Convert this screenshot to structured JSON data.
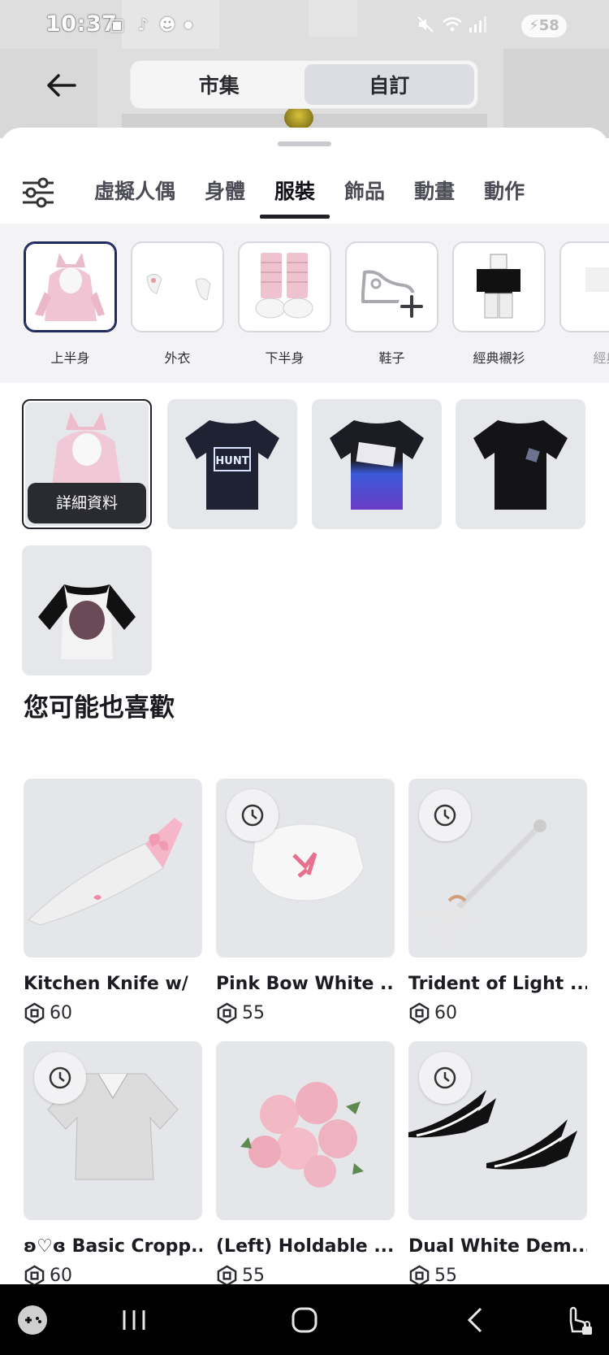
{
  "status_bar": {
    "time": "10:37",
    "battery": "58"
  },
  "top_nav": {
    "segments": [
      {
        "label": "市集",
        "active": false
      },
      {
        "label": "自訂",
        "active": true
      }
    ]
  },
  "category_tabs": [
    {
      "label": "虛擬人偶",
      "active": false
    },
    {
      "label": "身體",
      "active": false
    },
    {
      "label": "服裝",
      "active": true
    },
    {
      "label": "飾品",
      "active": false
    },
    {
      "label": "動畫",
      "active": false
    },
    {
      "label": "動作",
      "active": false
    }
  ],
  "subcategories": [
    {
      "label": "上半身",
      "icon": "pink-cat-hoodie-thumb",
      "active": true
    },
    {
      "label": "外衣",
      "icon": "outerwear-thumb",
      "active": false
    },
    {
      "label": "下半身",
      "icon": "pink-leg-warmers-thumb",
      "active": false
    },
    {
      "label": "鞋子",
      "icon": "add-shoe-icon",
      "active": false
    },
    {
      "label": "經典襯衫",
      "icon": "classic-shirt-thumb",
      "active": false
    },
    {
      "label": "經典",
      "icon": "classic-pants-thumb",
      "active": false
    }
  ],
  "owned_items": {
    "detail_label": "詳細資料",
    "items": [
      {
        "icon": "pink-cat-hoodie"
      },
      {
        "icon": "hunt-navy-tshirt"
      },
      {
        "icon": "gradient-blue-tshirt"
      },
      {
        "icon": "black-roblox-tshirt"
      },
      {
        "icon": "white-raglan-tshirt"
      }
    ]
  },
  "recommendations": {
    "title": "您可能也喜歡",
    "items": [
      {
        "name": "Kitchen Knife w/",
        "price": "60",
        "limited": false,
        "icon": "kitchen-knife"
      },
      {
        "name": "Pink Bow White ...",
        "price": "55",
        "limited": true,
        "icon": "pink-bow-top"
      },
      {
        "name": "Trident of Light ...",
        "price": "60",
        "limited": true,
        "icon": "trident"
      },
      {
        "name": "ʚ♡ɞ Basic Cropp...",
        "price": "60",
        "limited": true,
        "icon": "crop-top"
      },
      {
        "name": "(Left) Holdable ...",
        "price": "55",
        "limited": false,
        "icon": "rose-bouquet"
      },
      {
        "name": "Dual White Dem...",
        "price": "55",
        "limited": true,
        "icon": "demon-wings"
      }
    ]
  },
  "colors": {
    "accent_dark": "#202126",
    "card_bg": "#e5e6ea",
    "subcat_active_border": "#1f2a5c"
  }
}
